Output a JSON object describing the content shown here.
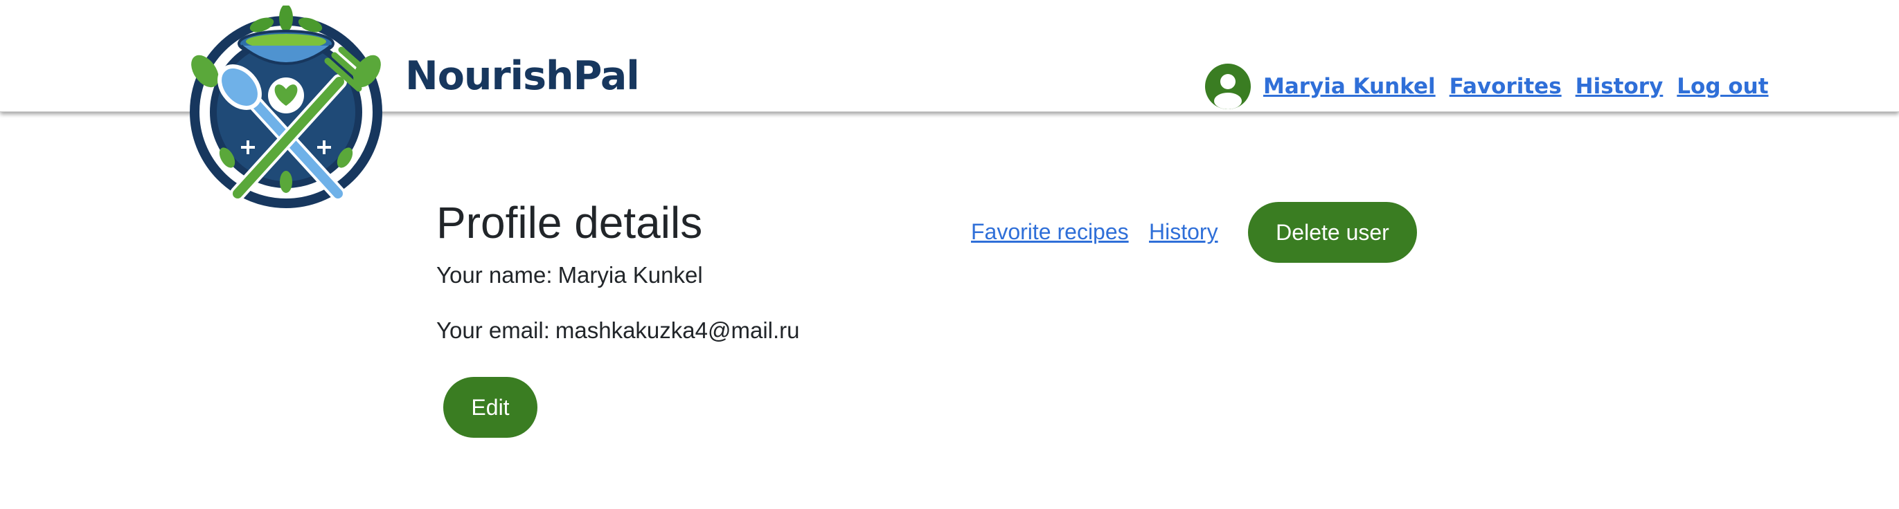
{
  "header": {
    "brand_name": "NourishPal",
    "nav": {
      "user_name": "Maryia Kunkel",
      "favorites": "Favorites",
      "history": "History",
      "logout": "Log out"
    }
  },
  "profile": {
    "title": "Profile details",
    "name_label": "Your name:",
    "name_value": "Maryia Kunkel",
    "email_label": "Your email:",
    "email_value": "mashkakuzka4@mail.ru",
    "edit_button": "Edit",
    "favorite_recipes_link": "Favorite recipes",
    "history_link": "History",
    "delete_button": "Delete user"
  },
  "icons": {
    "logo": "nourishpal-logo-icon",
    "avatar": "user-avatar-icon"
  },
  "colors": {
    "accent_green": "#3a7d22",
    "link_blue": "#2f6fd8",
    "brand_navy": "#17375e"
  }
}
